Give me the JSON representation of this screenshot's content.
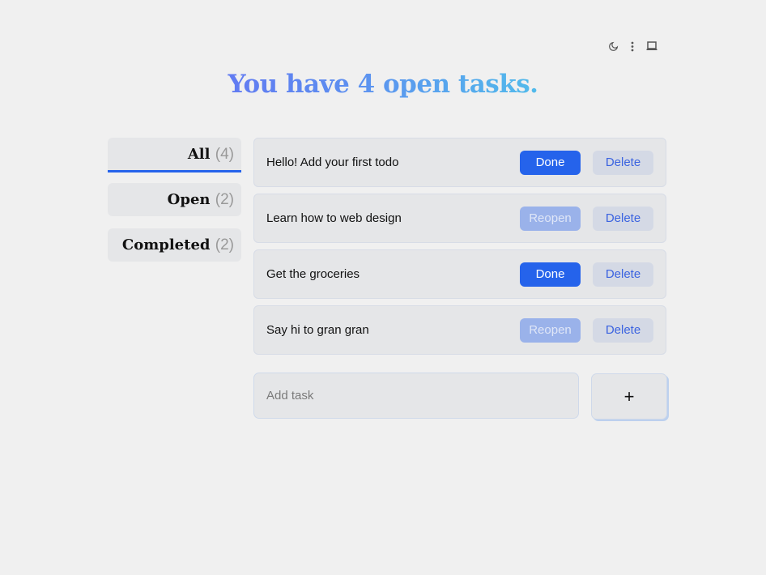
{
  "toolbar": {
    "icons": [
      "moon-icon",
      "more-vertical-icon",
      "laptop-icon"
    ]
  },
  "header": {
    "title": "You have 4 open tasks."
  },
  "filters": [
    {
      "label": "All",
      "count": "(4)",
      "active": true
    },
    {
      "label": "Open",
      "count": "(2)"
    },
    {
      "label": "Completed",
      "count": "(2)"
    }
  ],
  "tasks": [
    {
      "text": "Hello! Add your first todo",
      "action": "Done",
      "delete": "Delete"
    },
    {
      "text": "Learn how to web design",
      "action": "Reopen",
      "delete": "Delete"
    },
    {
      "text": "Get the groceries",
      "action": "Done",
      "delete": "Delete"
    },
    {
      "text": "Say hi to gran gran",
      "action": "Reopen",
      "delete": "Delete"
    }
  ],
  "add": {
    "placeholder": "Add task",
    "button": "+"
  },
  "colors": {
    "accent": "#2563eb",
    "gradient_start": "#6a55f5",
    "gradient_end": "#4ff0e4"
  }
}
